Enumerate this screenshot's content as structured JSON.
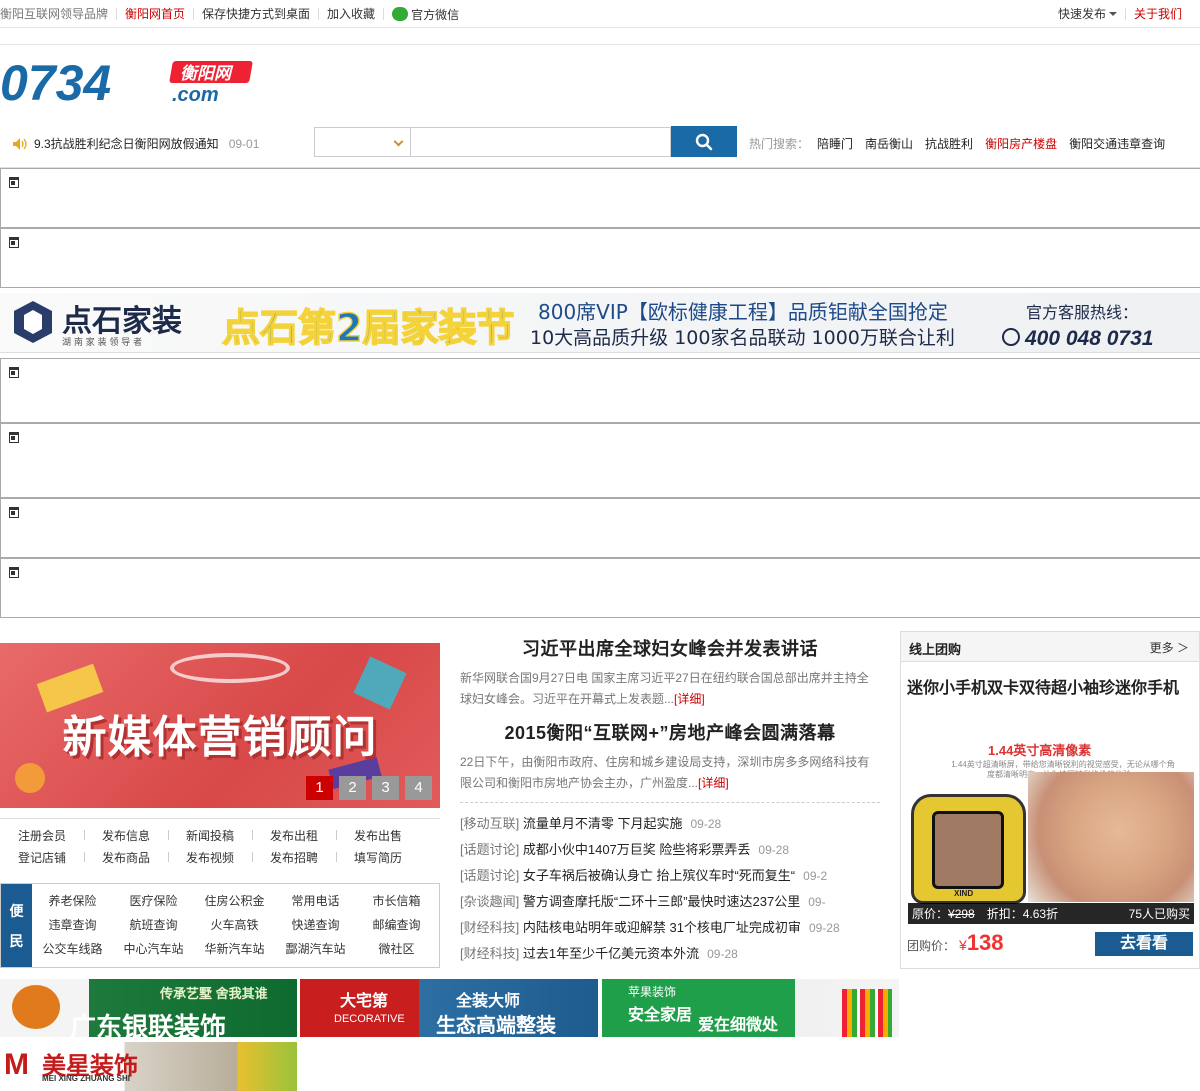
{
  "topbar": {
    "items": [
      "衡阳互联网领导品牌",
      "衡阳网首页",
      "保存快捷方式到桌面",
      "加入收藏",
      "官方微信"
    ],
    "quick_publish": "快速发布",
    "about": "关于我们"
  },
  "logo": {
    "main": "0734",
    "cn": "衡阳网",
    "dotcom": ".com"
  },
  "notice": {
    "text": "9.3抗战胜利纪念日衡阳网放假通知",
    "date": "09-01"
  },
  "search": {
    "placeholder": "",
    "select_value": ""
  },
  "hot": {
    "label": "热门搜索：",
    "items": [
      "陪睡门",
      "南岳衡山",
      "抗战胜利",
      "衡阳房产楼盘",
      "衡阳交通违章查询"
    ]
  },
  "banner1": {
    "brand": "点石家装",
    "brand_sub": "湖 南 家 装 领 导 者",
    "headline": "点石第2届家装节",
    "line1": "800席VIP【欧标健康工程】品质钜献全国抢定",
    "line2": "10大高品质升级  100家名品联动  1000万联合让利",
    "hotline_label": "官方客服热线：",
    "hotline": "400 048 0731"
  },
  "slider": {
    "title": "新媒体营销顾问",
    "pages": [
      "1",
      "2",
      "3",
      "4"
    ],
    "active": "1"
  },
  "links": {
    "row1": [
      "注册会员",
      "发布信息",
      "新闻投稿",
      "发布出租",
      "发布出售"
    ],
    "row2": [
      "登记店铺",
      "发布商品",
      "发布视频",
      "发布招聘",
      "填写简历"
    ]
  },
  "bianmin": {
    "label1": "便",
    "label2": "民",
    "row1": [
      "养老保险",
      "医疗保险",
      "住房公积金",
      "常用电话",
      "市长信箱"
    ],
    "row2": [
      "违章查询",
      "航班查询",
      "火车高铁",
      "快递查询",
      "邮编查询"
    ],
    "row3": [
      "公交车线路",
      "中心汽车站",
      "华新汽车站",
      "酃湖汽车站",
      "微社区"
    ]
  },
  "news": {
    "h1": "习近平出席全球妇女峰会并发表讲话",
    "p1": "新华网联合国9月27日电 国家主席习近平27日在纽约联合国总部出席并主持全球妇女峰会。习近平在开幕式上发表题...",
    "more": "[详细]",
    "h2": "2015衡阳“互联网+”房地产峰会圆满落幕",
    "p2": "22日下午，由衡阳市政府、住房和城乡建设局支持，深圳市房多多网络科技有限公司和衡阳市房地产协会主办，广州盈度...",
    "list": [
      {
        "cat": "[移动互联]",
        "t": "流量单月不清零 下月起实施",
        "d": "09-28"
      },
      {
        "cat": "[话题讨论]",
        "t": "成都小伙中1407万巨奖 险些将彩票弄丢",
        "d": "09-28"
      },
      {
        "cat": "[话题讨论]",
        "t": "女子车祸后被确认身亡 抬上殡仪车时“死而复生“",
        "d": "09-2"
      },
      {
        "cat": "[杂谈趣闻]",
        "t": "警方调查摩托版“二环十三郎”最快时速达237公里",
        "d": "09-"
      },
      {
        "cat": "[财经科技]",
        "t": "内陆核电站明年或迎解禁 31个核电厂址完成初审",
        "d": "09-28"
      },
      {
        "cat": "[财经科技]",
        "t": "过去1年至少千亿美元资本外流",
        "d": "09-28"
      }
    ]
  },
  "tuan": {
    "header": "线上团购",
    "more": "更多 ＞",
    "title": "迷你小手机双卡双待超小袖珍迷你手机",
    "img_caption": "1.44英寸高清像素",
    "img_small": "1.44英寸超清晰屏，带给您清晰锐利的视觉感受，无论从哪个角度都清晰明亮，让你拍照精彩绝伦的体验。",
    "phone_brand": "XIND",
    "orig_label": "原价：",
    "orig_price": "¥298",
    "discount": "折扣：4.63折",
    "bought": "75人已购买",
    "price_label": "团购价：",
    "price_sym": "¥",
    "price": "138",
    "go": "去看看"
  },
  "ads": {
    "ad1_small": "传承艺墅 舍我其谁",
    "ad1_main": "广东银联装饰",
    "ad2_brand": "大宅第",
    "ad2_sub": "DECORATIVE",
    "ad2_top": "全装大师",
    "ad2_main": "生态高端整装",
    "ad3_brand": "苹果装饰",
    "ad3_line1": "安全家居",
    "ad3_line2": "爱在细微处",
    "ad4_main": "美星装饰",
    "ad4_sub": "MEI XING ZHUANG SHI"
  },
  "colors": {
    "brand_blue": "#1a6aa8",
    "accent_red": "#cc0000",
    "dark_blue": "#1a5b92"
  }
}
